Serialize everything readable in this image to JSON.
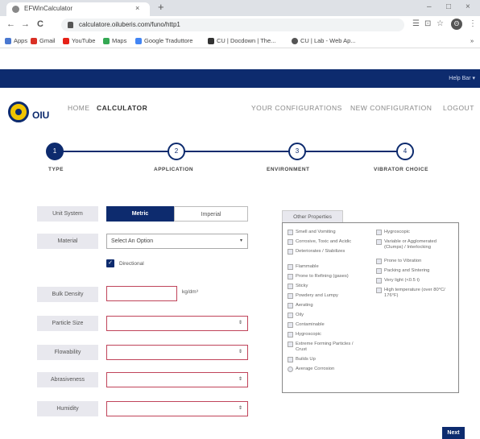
{
  "browser": {
    "tab_title": "EFWinCalculator",
    "tab_close": "×",
    "new_tab": "+",
    "window_controls": [
      "–",
      "□",
      "×"
    ],
    "nav": {
      "back": "←",
      "forward": "→",
      "reload": "C"
    },
    "url": "calculatore.oiluberis.com/funo/http1",
    "toolbar_icons": [
      "☰",
      "⊡",
      "☆",
      "⋮"
    ],
    "profile": "Θ",
    "bookmarks": [
      {
        "label": "Apps",
        "color": "#4a78d0"
      },
      {
        "label": "Gmail",
        "color": "#d93025"
      },
      {
        "label": "YouTube",
        "color": "#e62117"
      },
      {
        "label": "Maps",
        "color": "#34a853"
      },
      {
        "label": "Google Traduttore",
        "color": "#4285f4"
      },
      {
        "label": "CU | Docdown | The...",
        "color": "#333333"
      },
      {
        "label": "CU | Lab - Web Ap...",
        "color": "#555555"
      }
    ],
    "bookmarks_more": "»"
  },
  "topbar": {
    "right_link": "Help Bar ▾"
  },
  "header": {
    "logo_text": "OIU",
    "nav": {
      "home": "HOME",
      "calculator": "CALCULATOR",
      "your_configurations": "YOUR CONFIGURATIONS",
      "new_configuration": "NEW CONFIGURATION",
      "logout": "LOGOUT"
    }
  },
  "stepper": {
    "steps": [
      {
        "num": "1",
        "label": "TYPE",
        "active": true
      },
      {
        "num": "2",
        "label": "APPLICATION",
        "active": false
      },
      {
        "num": "3",
        "label": "ENVIRONMENT",
        "active": false
      },
      {
        "num": "4",
        "label": "VIBRATOR CHOICE",
        "active": false
      }
    ]
  },
  "form": {
    "unit_system": {
      "label": "Unit System",
      "metric": "Metric",
      "imperial": "Imperial"
    },
    "material": {
      "label": "Material",
      "value": "Select An Option",
      "caret": "▾"
    },
    "checkbox": {
      "label": "Directional",
      "checked": true,
      "mark": "✓"
    },
    "bulk_density": {
      "label": "Bulk Density",
      "value": "",
      "unit": "kg/dm³"
    },
    "particle_size": {
      "label": "Particle Size",
      "value": "",
      "caret": "⇕"
    },
    "flowability": {
      "label": "Flowability",
      "value": "",
      "caret": "⇕"
    },
    "abrasiveness": {
      "label": "Abrasiveness",
      "value": "",
      "caret": "⇕"
    },
    "humidity": {
      "label": "Humidity",
      "value": "",
      "caret": "⇕"
    }
  },
  "filter": {
    "tab_label": "Other Properties",
    "col1": [
      "Smell and Vomiting",
      "Corrosive, Toxic and Acidic",
      "Deteriorates / Stabilizes",
      "Flammable",
      "Prone to Refining (gases)",
      "Sticky",
      "Powdery and Lumpy",
      "Aerating",
      "Oily",
      "Contaminable",
      "Hygroscopic",
      "Extreme Forming Particles / Crust",
      "Builds Up",
      "Average Corrosion"
    ],
    "col2": [
      "Hygroscopic",
      "Variable or Agglomerated (Clumps) / Interlocking",
      "Prone to Vibration",
      "Packing and Sintering",
      "Very light (<0.5 t)",
      "High temperature (over 80°C/ 176°F)"
    ]
  },
  "next_button": "Next"
}
